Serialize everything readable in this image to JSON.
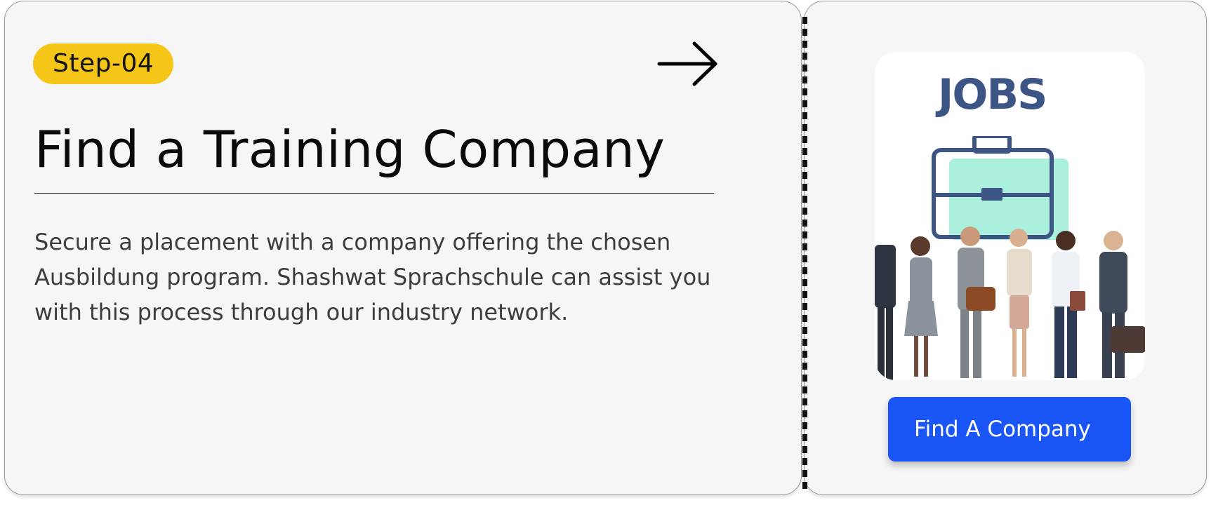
{
  "step": {
    "badge_label": "Step-04"
  },
  "main": {
    "title": "Find a Training Company",
    "description": "Secure a placement with a company offering the chosen Ausbildung program. Shashwat Sprachschule can assist you with this process through our industry network."
  },
  "side": {
    "image_caption": "JOBS",
    "button_label": "Find A Company"
  },
  "colors": {
    "badge": "#f5c518",
    "button": "#1a56f5",
    "jobs_text": "#3d5584",
    "briefcase_fill": "#aaf0dc"
  },
  "icons": {
    "next": "arrow-right-icon",
    "illustration": "briefcase-icon"
  }
}
